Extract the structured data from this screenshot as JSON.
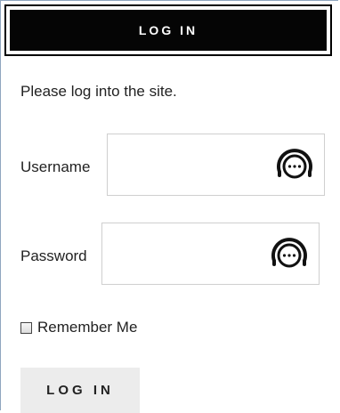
{
  "header": {
    "title": "LOG IN"
  },
  "intro": "Please log into the site.",
  "fields": {
    "username": {
      "label": "Username",
      "value": "",
      "icon": "password-manager-icon"
    },
    "password": {
      "label": "Password",
      "value": "",
      "icon": "password-manager-icon"
    }
  },
  "remember": {
    "label": "Remember Me",
    "checked": false
  },
  "submit": {
    "label": "LOG IN"
  },
  "colors": {
    "header_bg": "#050505",
    "button_bg": "#ececec",
    "input_border": "#cfcfcf"
  }
}
